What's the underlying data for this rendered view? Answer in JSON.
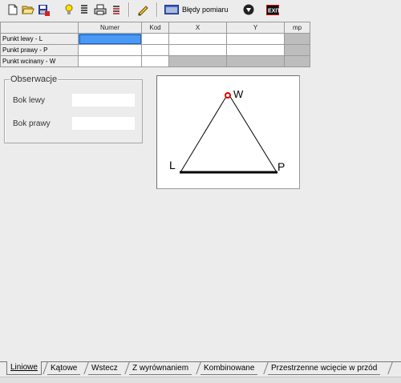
{
  "toolbar": {
    "errors_label": "Błędy pomiaru",
    "icons": [
      "new-file",
      "open-folder",
      "save",
      "lightbulb",
      "list",
      "print",
      "stack",
      "pencil",
      "errors-window",
      "down-arrow",
      "exit"
    ]
  },
  "grid": {
    "headers": [
      "Numer",
      "Kod",
      "X",
      "Y",
      "mp"
    ],
    "rows": [
      {
        "label": "Punkt lewy - L"
      },
      {
        "label": "Punkt prawy - P"
      },
      {
        "label": "Punkt wcinany - W"
      }
    ]
  },
  "obserwacje": {
    "title": "Obserwacje",
    "bok_lewy": "Bok lewy",
    "bok_prawy": "Bok prawy"
  },
  "diagram": {
    "L": "L",
    "P": "P",
    "W": "W"
  },
  "tabs": [
    {
      "label": "Liniowe",
      "active": true
    },
    {
      "label": "Kątowe"
    },
    {
      "label": "Wstecz"
    },
    {
      "label": "Z wyrównaniem"
    },
    {
      "label": "Kombinowane"
    },
    {
      "label": "Przestrzenne wcięcie w przód"
    }
  ]
}
